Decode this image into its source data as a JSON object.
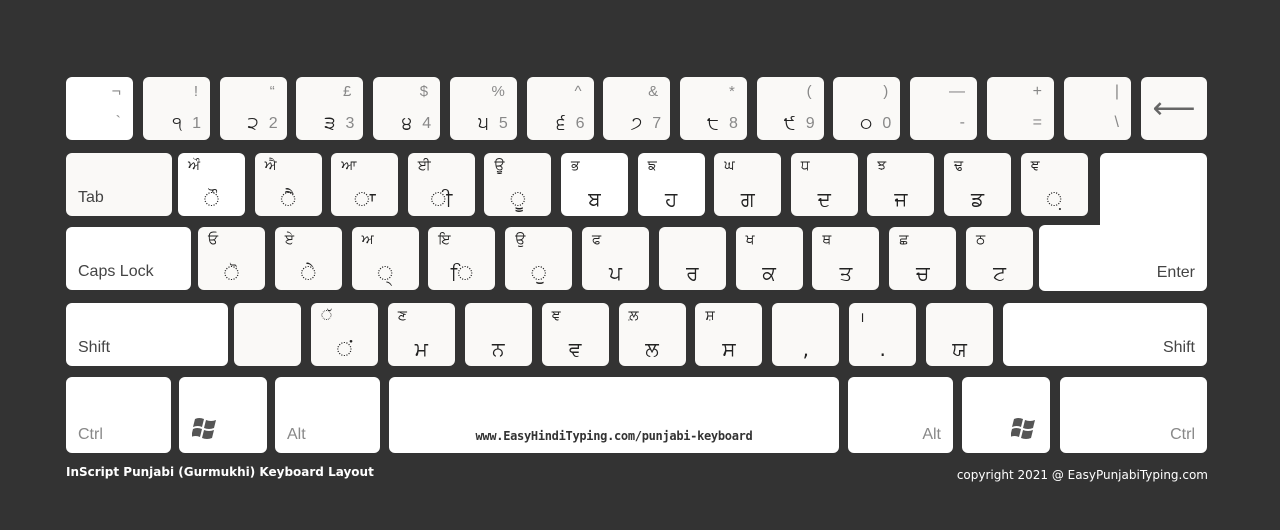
{
  "title": "InScript Punjabi (Gurmukhi) Keyboard Layout",
  "copyright": "copyright 2021 @ EasyPunjabiTyping.com",
  "url_on_spacebar": "www.EasyHindiTyping.com/punjabi-keyboard",
  "row1": {
    "backtick": {
      "top": "¬",
      "bottom": "`"
    },
    "keys": [
      {
        "shift": "!",
        "gurmukhi": "੧",
        "latin": "1"
      },
      {
        "shift": "“",
        "gurmukhi": "੨",
        "latin": "2"
      },
      {
        "shift": "£",
        "gurmukhi": "੩",
        "latin": "3"
      },
      {
        "shift": "$",
        "gurmukhi": "੪",
        "latin": "4"
      },
      {
        "shift": "%",
        "gurmukhi": "੫",
        "latin": "5"
      },
      {
        "shift": "^",
        "gurmukhi": "੬",
        "latin": "6"
      },
      {
        "shift": "&",
        "gurmukhi": "੭",
        "latin": "7"
      },
      {
        "shift": "*",
        "gurmukhi": "੮",
        "latin": "8"
      },
      {
        "shift": "(",
        "gurmukhi": "੯",
        "latin": "9"
      },
      {
        "shift": ")",
        "gurmukhi": "੦",
        "latin": "0"
      }
    ],
    "minus": {
      "top": "—",
      "bottom": "-"
    },
    "equals": {
      "top": "+",
      "bottom": "="
    },
    "backslash": {
      "top": "|",
      "bottom": "\\"
    },
    "backspace": {
      "icon": "backspace-arrow-icon",
      "glyph": "⟵"
    }
  },
  "row2": {
    "tab_label": "Tab",
    "keys": [
      {
        "top": "ਔ",
        "bottom": "ੌ"
      },
      {
        "top": "ਐ",
        "bottom": "ੈ"
      },
      {
        "top": "ਆ",
        "bottom": "ਾ"
      },
      {
        "top": "ਈ",
        "bottom": "ੀ"
      },
      {
        "top": "ਊ",
        "bottom": "ੂ"
      },
      {
        "top": "ਭ",
        "bottom": "ਬ"
      },
      {
        "top": "ਙ",
        "bottom": "ਹ"
      },
      {
        "top": "ਘ",
        "bottom": "ਗ"
      },
      {
        "top": "ਧ",
        "bottom": "ਦ"
      },
      {
        "top": "ਝ",
        "bottom": "ਜ"
      },
      {
        "top": "ਢ",
        "bottom": "ਡ"
      },
      {
        "top": "ਞ",
        "bottom": "਼"
      }
    ]
  },
  "row3": {
    "caps_label": "Caps Lock",
    "keys": [
      {
        "top": "ਓ",
        "bottom": "ੋ"
      },
      {
        "top": "ਏ",
        "bottom": "ੇ"
      },
      {
        "top": "ਅ",
        "bottom": "੍"
      },
      {
        "top": "ਇ",
        "bottom": "ਿ"
      },
      {
        "top": "ਉ",
        "bottom": "ੁ"
      },
      {
        "top": "ਫ",
        "bottom": "ਪ"
      },
      {
        "top": "",
        "bottom": "ਰ"
      },
      {
        "top": "ਖ",
        "bottom": "ਕ"
      },
      {
        "top": "ਥ",
        "bottom": "ਤ"
      },
      {
        "top": "ਛ",
        "bottom": "ਚ"
      },
      {
        "top": "ਠ",
        "bottom": "ਟ"
      }
    ],
    "enter_label": "Enter"
  },
  "row4": {
    "shift_left_label": "Shift",
    "keys": [
      {
        "top": "",
        "bottom": ""
      },
      {
        "top": "ੱ",
        "bottom": "ਂ"
      },
      {
        "top": "ਣ",
        "bottom": "ਮ"
      },
      {
        "top": "",
        "bottom": "ਨ"
      },
      {
        "top": "ਞ",
        "bottom": "ਵ"
      },
      {
        "top": "ਲ਼",
        "bottom": "ਲ"
      },
      {
        "top": "ਸ਼",
        "bottom": "ਸ"
      },
      {
        "top": "",
        "bottom": ","
      },
      {
        "top": "।",
        "bottom": "."
      },
      {
        "top": "",
        "bottom": "ਯ"
      }
    ],
    "shift_right_label": "Shift"
  },
  "row5": {
    "ctrl_left": "Ctrl",
    "win_left": "windows-logo-icon",
    "alt_left": "Alt",
    "alt_right": "Alt",
    "win_right": "windows-logo-icon",
    "ctrl_right": "Ctrl"
  }
}
